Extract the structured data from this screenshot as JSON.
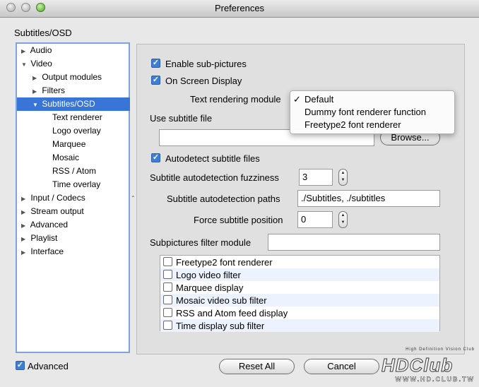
{
  "window": {
    "title": "Preferences"
  },
  "section_title": "Subtitles/OSD",
  "tree": {
    "items": [
      {
        "label": "Audio",
        "expander": "▶"
      },
      {
        "label": "Video",
        "expander": "▼"
      },
      {
        "label": "Output modules",
        "expander": "▶"
      },
      {
        "label": "Filters",
        "expander": "▶"
      },
      {
        "label": "Subtitles/OSD",
        "expander": "▼"
      },
      {
        "label": "Text renderer",
        "expander": ""
      },
      {
        "label": "Logo overlay",
        "expander": ""
      },
      {
        "label": "Marquee",
        "expander": ""
      },
      {
        "label": "Mosaic",
        "expander": ""
      },
      {
        "label": "RSS / Atom",
        "expander": ""
      },
      {
        "label": "Time overlay",
        "expander": ""
      },
      {
        "label": "Input / Codecs",
        "expander": "▶"
      },
      {
        "label": "Stream output",
        "expander": "▶"
      },
      {
        "label": "Advanced",
        "expander": "▶"
      },
      {
        "label": "Playlist",
        "expander": "▶"
      },
      {
        "label": "Interface",
        "expander": "▶"
      }
    ],
    "selected": "Subtitles/OSD"
  },
  "settings": {
    "enable_subpictures": {
      "label": "Enable sub-pictures",
      "checked": true
    },
    "osd": {
      "label": "On Screen Display",
      "checked": true
    },
    "text_rendering_module": {
      "label": "Text rendering module",
      "selected": "Default"
    },
    "use_subtitle_file": {
      "label": "Use subtitle file",
      "value": "",
      "browse_label": "Browse..."
    },
    "autodetect": {
      "label": "Autodetect subtitle files",
      "checked": true
    },
    "fuzziness": {
      "label": "Subtitle autodetection fuzziness",
      "value": "3"
    },
    "paths": {
      "label": "Subtitle autodetection paths",
      "value": "./Subtitles, ./subtitles"
    },
    "force_position": {
      "label": "Force subtitle position",
      "value": "0"
    },
    "filter_module": {
      "label": "Subpictures filter module",
      "value": ""
    }
  },
  "dropdown": {
    "options": [
      "Default",
      "Dummy font renderer function",
      "Freetype2 font renderer"
    ],
    "checkmark": "✓"
  },
  "filter_list": [
    {
      "label": "Freetype2 font renderer",
      "checked": false
    },
    {
      "label": "Logo video filter",
      "checked": false
    },
    {
      "label": "Marquee display",
      "checked": false
    },
    {
      "label": "Mosaic video sub filter",
      "checked": false
    },
    {
      "label": "RSS and Atom feed display",
      "checked": false
    },
    {
      "label": "Time display sub filter",
      "checked": false
    }
  ],
  "footer": {
    "advanced": {
      "label": "Advanced",
      "checked": true
    },
    "reset_label": "Reset All",
    "cancel_label": "Cancel"
  },
  "watermark": {
    "tagline": "High Definition Vision Club",
    "logo": "HDClub",
    "url": "WWW.HD.CLUB.TW"
  },
  "colors": {
    "selection": "#3875d7",
    "check": "#3d7fd6"
  }
}
